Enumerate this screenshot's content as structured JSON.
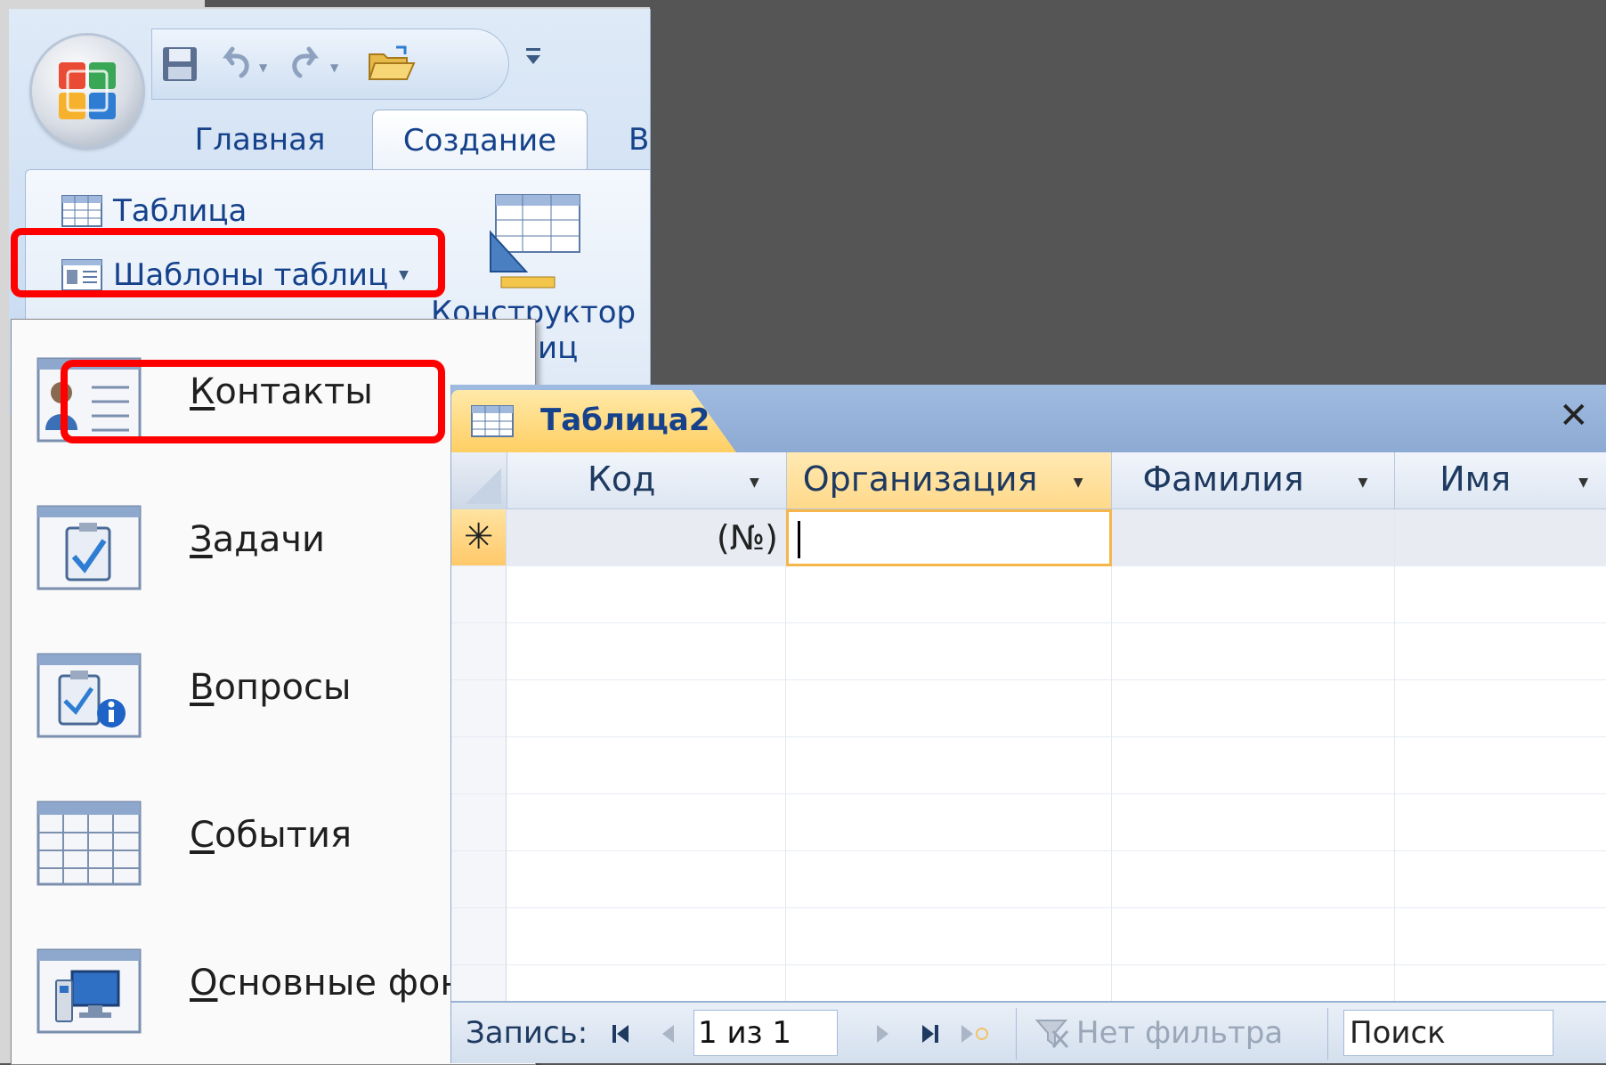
{
  "ribbon": {
    "tabs": [
      {
        "label": "Главная"
      },
      {
        "label": "Создание"
      },
      {
        "label": "В"
      }
    ],
    "table_label": "Таблица",
    "templates_label": "Шаблоны таблиц",
    "designer_label_line1": "Конструктор",
    "designer_label_line2": "иц"
  },
  "menu": {
    "items": [
      {
        "accel": "К",
        "rest": "онтакты"
      },
      {
        "accel": "З",
        "rest": "адачи"
      },
      {
        "accel": "В",
        "rest": "опросы"
      },
      {
        "accel": "С",
        "rest": "обытия"
      },
      {
        "accel": "О",
        "rest": "сновные фон"
      }
    ]
  },
  "datasheet": {
    "tab_title": "Таблица2",
    "close_glyph": "✕",
    "columns": [
      {
        "label": "Код"
      },
      {
        "label": "Организация"
      },
      {
        "label": "Фамилия"
      },
      {
        "label": "Имя"
      }
    ],
    "new_row_marker": "✳",
    "new_row_code": "(№)",
    "nav": {
      "record_label": "Запись:",
      "position": "1 из 1",
      "filter_label": "Нет фильтра",
      "search_label": "Поиск"
    }
  },
  "colors": {
    "highlight": "#ff0000",
    "active_header": "#ffd98a",
    "title_text": "#15428b"
  }
}
